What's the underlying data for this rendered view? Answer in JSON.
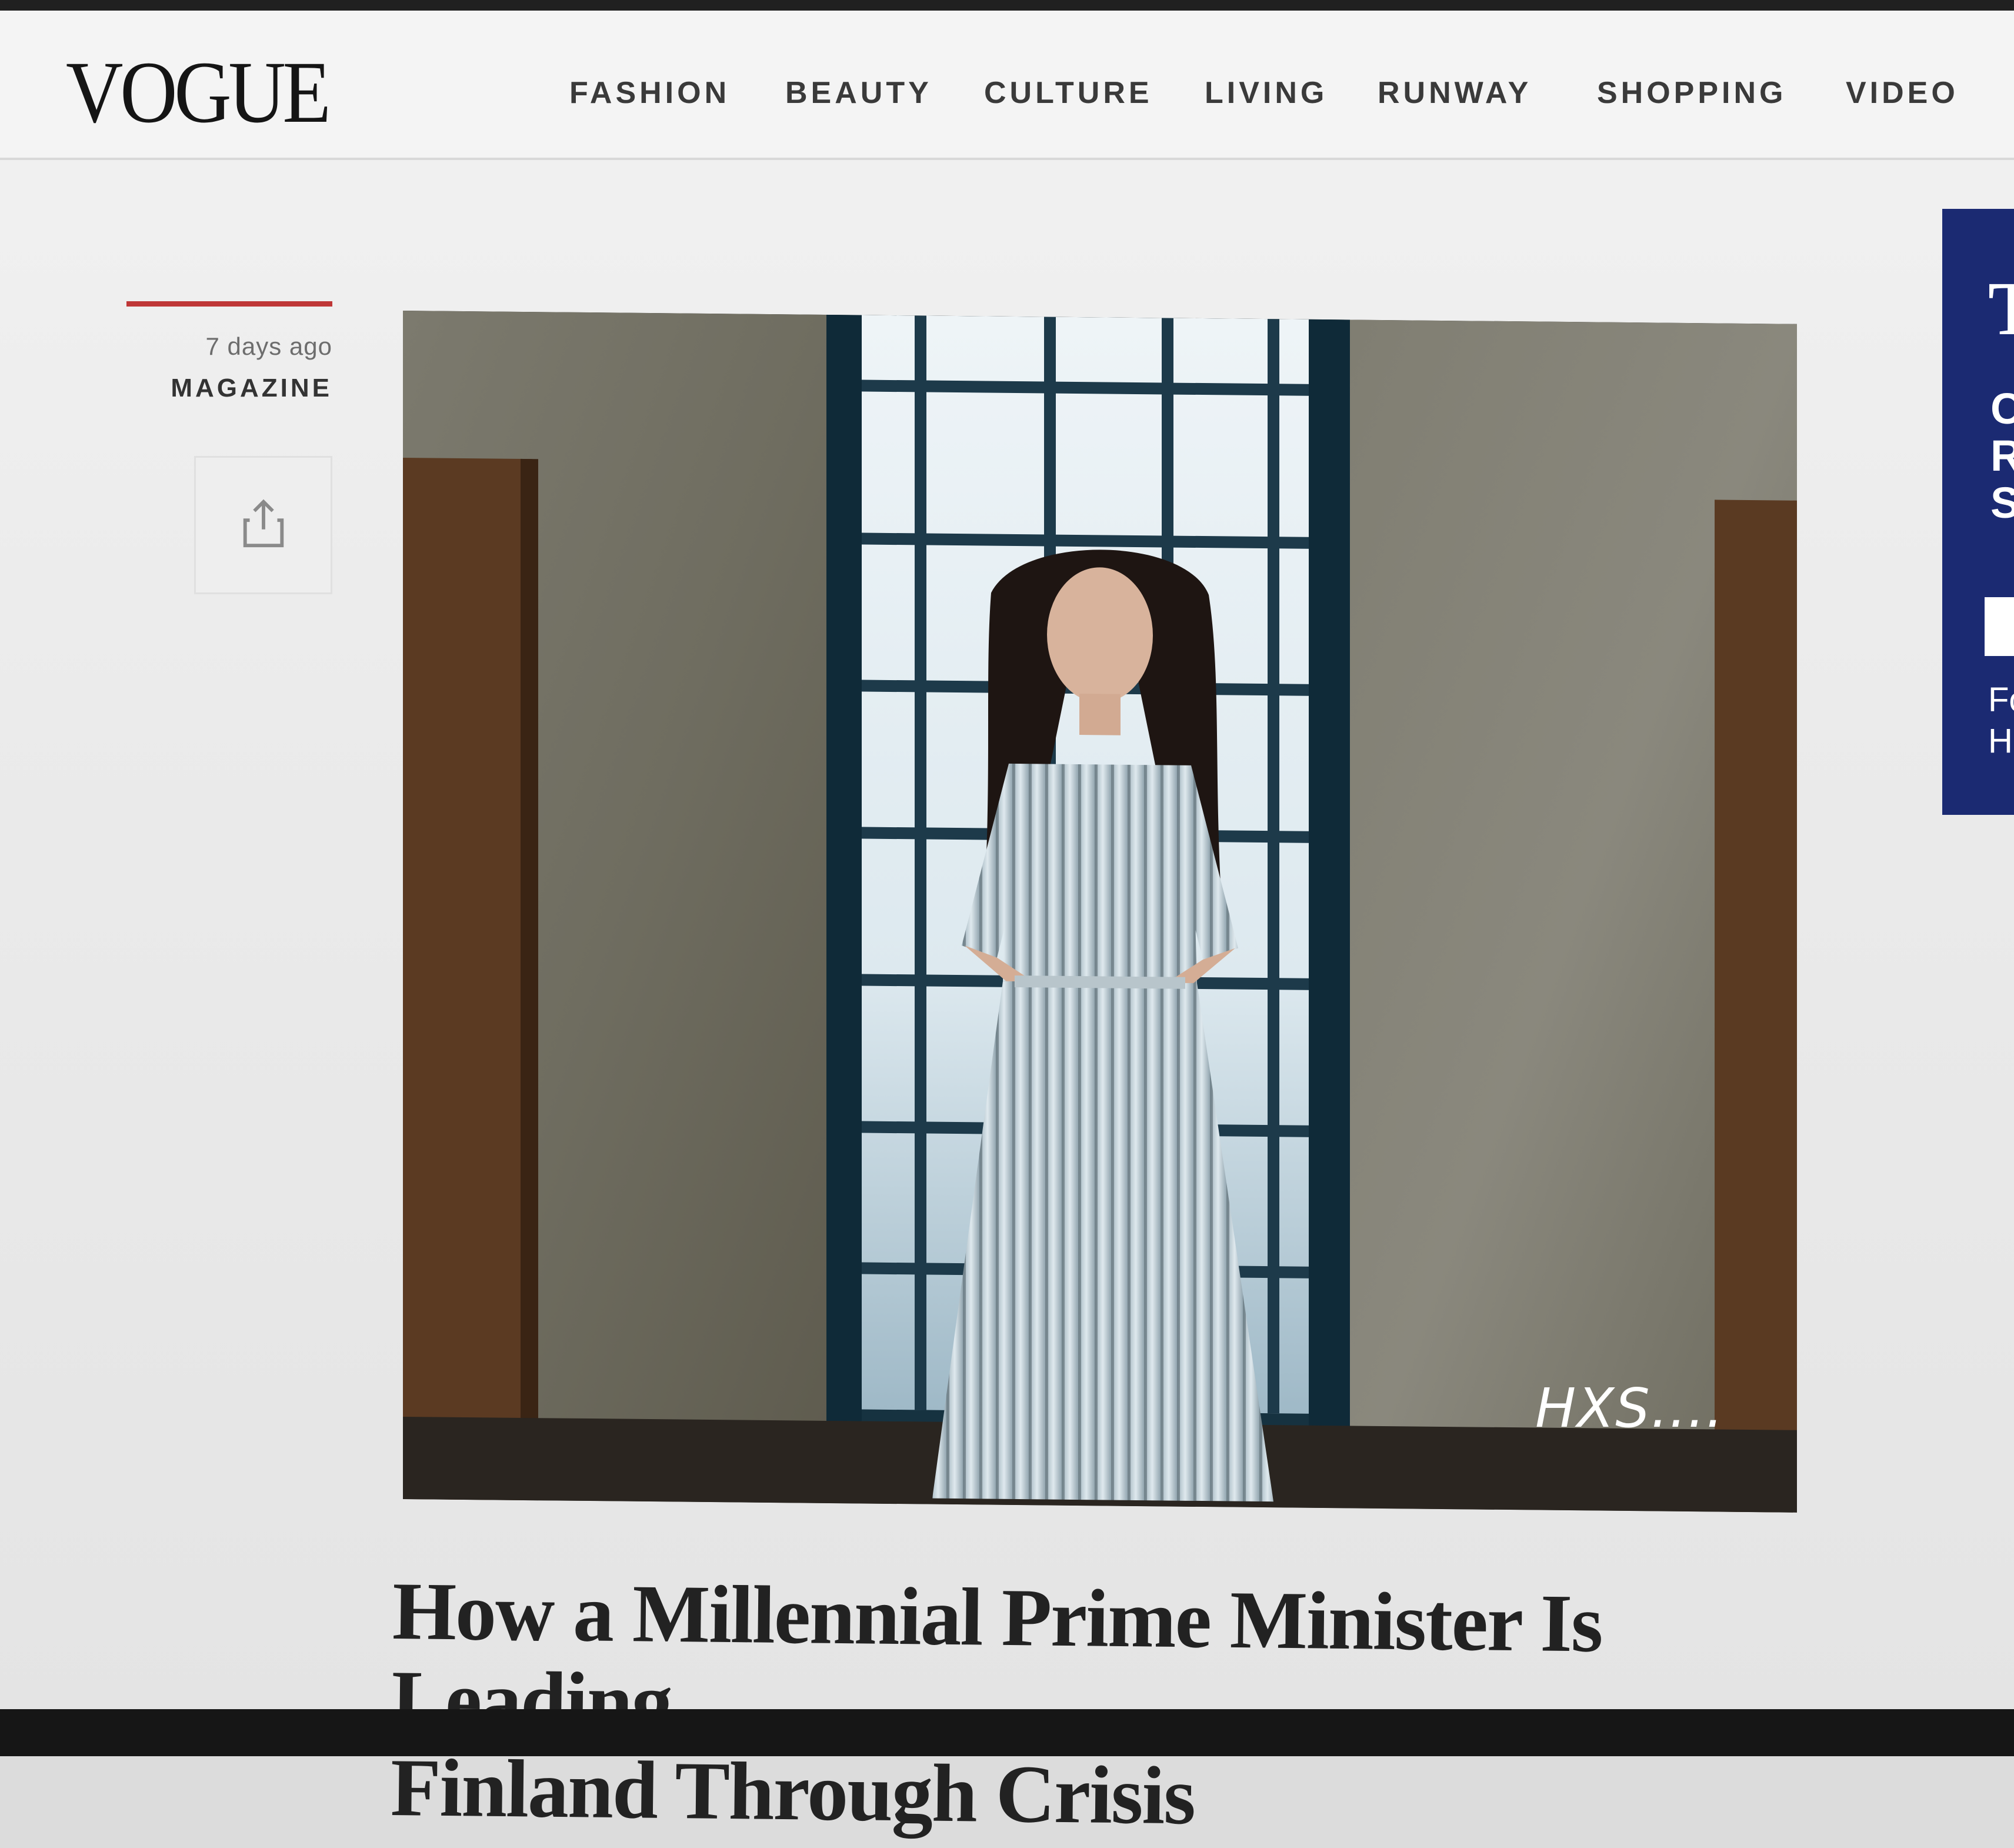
{
  "header": {
    "logo": "VOGUE",
    "nav": [
      "FASHION",
      "BEAUTY",
      "CULTURE",
      "LIVING",
      "RUNWAY",
      "SHOPPING",
      "VIDEO"
    ]
  },
  "article": {
    "timestamp": "7 days ago",
    "category": "MAGAZINE",
    "headline_line1": "How a Millennial Prime Minister Is Leading",
    "headline_line2": "Finland Through Crisis",
    "watermark": "HXS...."
  },
  "icons": {
    "share": "share-icon"
  },
  "colors": {
    "accent": "#bf3737",
    "ad_background": "#1b2a72",
    "text": "#222222"
  },
  "ad": {
    "heading": "T",
    "lines": [
      "C",
      "R",
      "S"
    ],
    "foot": [
      "Fo",
      "Ho"
    ]
  }
}
